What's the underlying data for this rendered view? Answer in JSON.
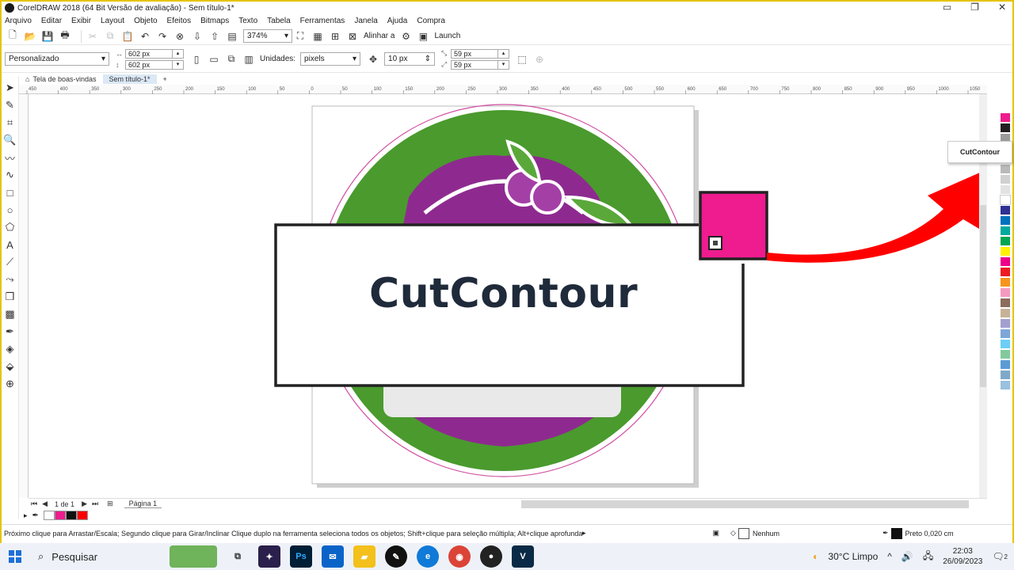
{
  "window": {
    "title": "CorelDRAW 2018 (64 Bit Versão de avaliação) - Sem título-1*",
    "controls": [
      "▭",
      "❐",
      "✕"
    ]
  },
  "menu": [
    "Arquivo",
    "Editar",
    "Exibir",
    "Layout",
    "Objeto",
    "Efeitos",
    "Bitmaps",
    "Texto",
    "Tabela",
    "Ferramentas",
    "Janela",
    "Ajuda",
    "Compra"
  ],
  "toolbar": {
    "zoom": "374%",
    "align_label": "Alinhar a",
    "launch_label": "Launch"
  },
  "propertybar": {
    "page_preset": "Personalizado",
    "width": "602 px",
    "height": "602 px",
    "units_label": "Unidades:",
    "units": "pixels",
    "nudge": "10 px",
    "dup_x": "59 px",
    "dup_y": "59 px"
  },
  "tabs": {
    "welcome": "Tela de boas-vindas",
    "doc": "Sem título-1*",
    "add": "+"
  },
  "ruler_ticks": [
    "450",
    "400",
    "350",
    "300",
    "250",
    "200",
    "150",
    "100",
    "50",
    "0",
    "50",
    "100",
    "150",
    "200",
    "250",
    "300",
    "350",
    "400",
    "450",
    "500",
    "550",
    "600",
    "650",
    "700",
    "750",
    "800",
    "850",
    "900",
    "950",
    "1000",
    "1050"
  ],
  "popup": {
    "label": "CutContour"
  },
  "zoom_callout": {
    "label": "CutContour"
  },
  "pagebar": {
    "page_of": "1  de  1",
    "page_tab": "Página 1"
  },
  "statusbar": {
    "hint": "Próximo clique para Arrastar/Escala; Segundo clique para Girar/Inclinar Clique duplo na ferramenta seleciona todos os objetos; Shift+clique para seleção múltipla; Alt+clique aprofunda",
    "fill": "Nenhum",
    "outline": "Preto  0,020 cm"
  },
  "taskbar": {
    "search": "Pesquisar",
    "weather": "30°C  Limpo",
    "time": "22:03",
    "date": "26/09/2023",
    "notif_count": "2"
  },
  "colors": {
    "magenta": "#ee1c8e",
    "green": "#4a9a2e",
    "purple": "#8e2a8f",
    "red_arrow": "#ff0000"
  }
}
